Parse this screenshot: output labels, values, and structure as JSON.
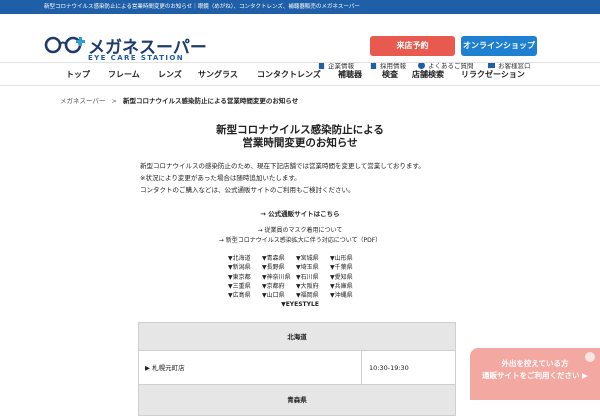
{
  "topbar": {
    "text": "新型コロナウイルス感染防止による営業時間変更のお知らせ｜眼鏡（めがね）、コンタクトレンズ、補聴器販売のメガネスーパー"
  },
  "logo": {
    "name": "メガネスーパー",
    "sub": "EYE CARE STATION"
  },
  "header": {
    "store_button": "来店予約",
    "online_button": "オンラインショップ",
    "utility_links": [
      {
        "label": "企業情報",
        "icon": "building-icon"
      },
      {
        "label": "採用情報",
        "icon": "document-icon"
      },
      {
        "label": "よくあるご質問",
        "icon": "question-icon"
      },
      {
        "label": "お客様窓口",
        "icon": "mail-icon"
      }
    ]
  },
  "nav": [
    "トップ",
    "フレーム",
    "レンズ",
    "サングラス",
    "コンタクトレンズ",
    "補聴器",
    "検査",
    "店舗検索",
    "リラクゼーション"
  ],
  "breadcrumb": {
    "home": "メガネスーパー",
    "sep": ">",
    "current": "新型コロナウイルス感染防止による営業時間変更のお知らせ"
  },
  "article": {
    "title_line1": "新型コロナウイルス感染防止による",
    "title_line2": "営業時間変更のお知らせ",
    "para1": "新型コロナウイルスの感染防止のため、現在下記店舗では営業時間を変更して営業しております。",
    "para2": "※状況により変更があった場合は随時追加いたします。",
    "para3": "コンタクトのご購入などは、公式通販サイトのご利用もご検討ください。",
    "official_link": "→ 公式通販サイトはこちら",
    "link1": "→ 従業員のマスク着用について",
    "link2": "→ 新型コロナウイルス感染拡大に伴う対応について（PDF）",
    "prefectures": [
      [
        "▼北海道",
        "▼青森県",
        "▼宮城県",
        "▼山形県"
      ],
      [
        "▼新潟県",
        "▼長野県",
        "▼埼玉県",
        "▼千葉県"
      ],
      [
        "▼東京都",
        "▼神奈川県",
        "▼石川県",
        "▼愛知県"
      ],
      [
        "▼三重県",
        "▼京都府",
        "▼大阪府",
        "▼兵庫県"
      ],
      [
        "▼広島県",
        "▼山口県",
        "▼福岡県",
        "▼沖縄県"
      ]
    ],
    "eyestyle": "▼EYESTYLE"
  },
  "table": {
    "region1": "北海道",
    "store1": "▶ 札幌元町店",
    "hours1": "10:30-19:30",
    "region2": "青森県"
  },
  "banner": {
    "line1": "外出を控えている方",
    "line2": "通販サイトをご利用ください ▶"
  }
}
